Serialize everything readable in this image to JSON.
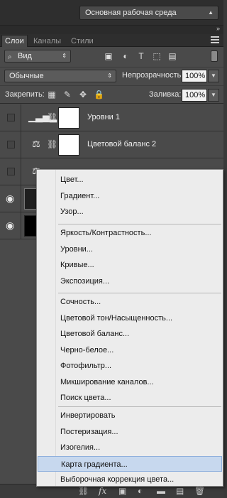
{
  "app_header": {
    "workspace": "Основная рабочая среда"
  },
  "tabs": [
    {
      "label": "Слои",
      "active": true
    },
    {
      "label": "Каналы",
      "active": false
    },
    {
      "label": "Стили",
      "active": false
    }
  ],
  "filter": {
    "kind_label": "Вид"
  },
  "blend": {
    "mode": "Обычные",
    "opacity_label": "Непрозрачность:",
    "opacity_value": "100%",
    "lock_label": "Закрепить:",
    "fill_label": "Заливка:",
    "fill_value": "100%"
  },
  "layers": [
    {
      "name": "Уровни 1",
      "visible": false,
      "icon": "levels-icon"
    },
    {
      "name": "Цветовой баланс 2",
      "visible": false,
      "icon": "balance-icon"
    },
    {
      "name": "",
      "visible": false,
      "icon": "balance-icon"
    },
    {
      "name": "",
      "visible": true,
      "icon": "photo-thumb"
    },
    {
      "name": "",
      "visible": true,
      "icon": "black-thumb"
    }
  ],
  "menu": {
    "group1": [
      "Цвет...",
      "Градиент...",
      "Узор..."
    ],
    "group2": [
      "Яркость/Контрастность...",
      "Уровни...",
      "Кривые...",
      "Экспозиция..."
    ],
    "group3": [
      "Сочность...",
      "Цветовой тон/Насыщенность...",
      "Цветовой баланс...",
      "Черно-белое...",
      "Фотофильтр...",
      "Микширование каналов...",
      "Поиск цвета..."
    ],
    "group4": [
      "Инвертировать",
      "Постеризация...",
      "Изогелия...",
      "Карта градиента...",
      "Выборочная коррекция цвета..."
    ],
    "highlighted": "Карта градиента..."
  },
  "bottom_bar": {
    "fx_label": "fx"
  }
}
